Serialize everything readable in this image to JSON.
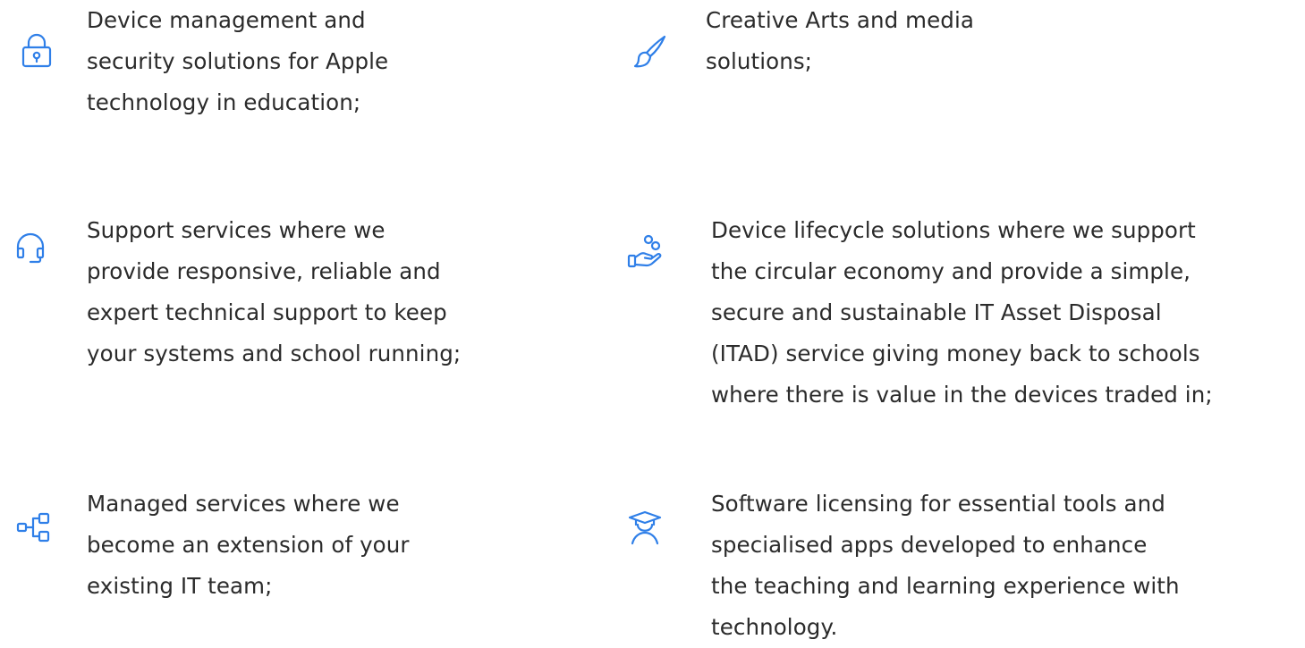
{
  "accent_color": "#2f7fe8",
  "features": [
    {
      "icon": "padlock-icon",
      "text": "Device management and\nsecurity solutions for Apple\ntechnology in education;"
    },
    {
      "icon": "paintbrush-icon",
      "text": "Creative Arts and media\nsolutions;"
    },
    {
      "icon": "headset-icon",
      "text": "Support services where we\nprovide responsive, reliable and\nexpert technical support to keep\nyour systems and school running;"
    },
    {
      "icon": "hand-with-coins-icon",
      "text": "Device lifecycle solutions where we support\nthe circular economy and provide a simple,\nsecure and sustainable IT Asset Disposal\n(ITAD) service giving money back to schools\nwhere there is value in the devices traded in;"
    },
    {
      "icon": "network-nodes-icon",
      "text": "Managed services where we\nbecome an extension of your\nexisting IT team;"
    },
    {
      "icon": "graduate-icon",
      "text": "Software licensing for essential tools and\nspecialised apps developed to enhance\nthe teaching and learning experience with\ntechnology."
    }
  ]
}
